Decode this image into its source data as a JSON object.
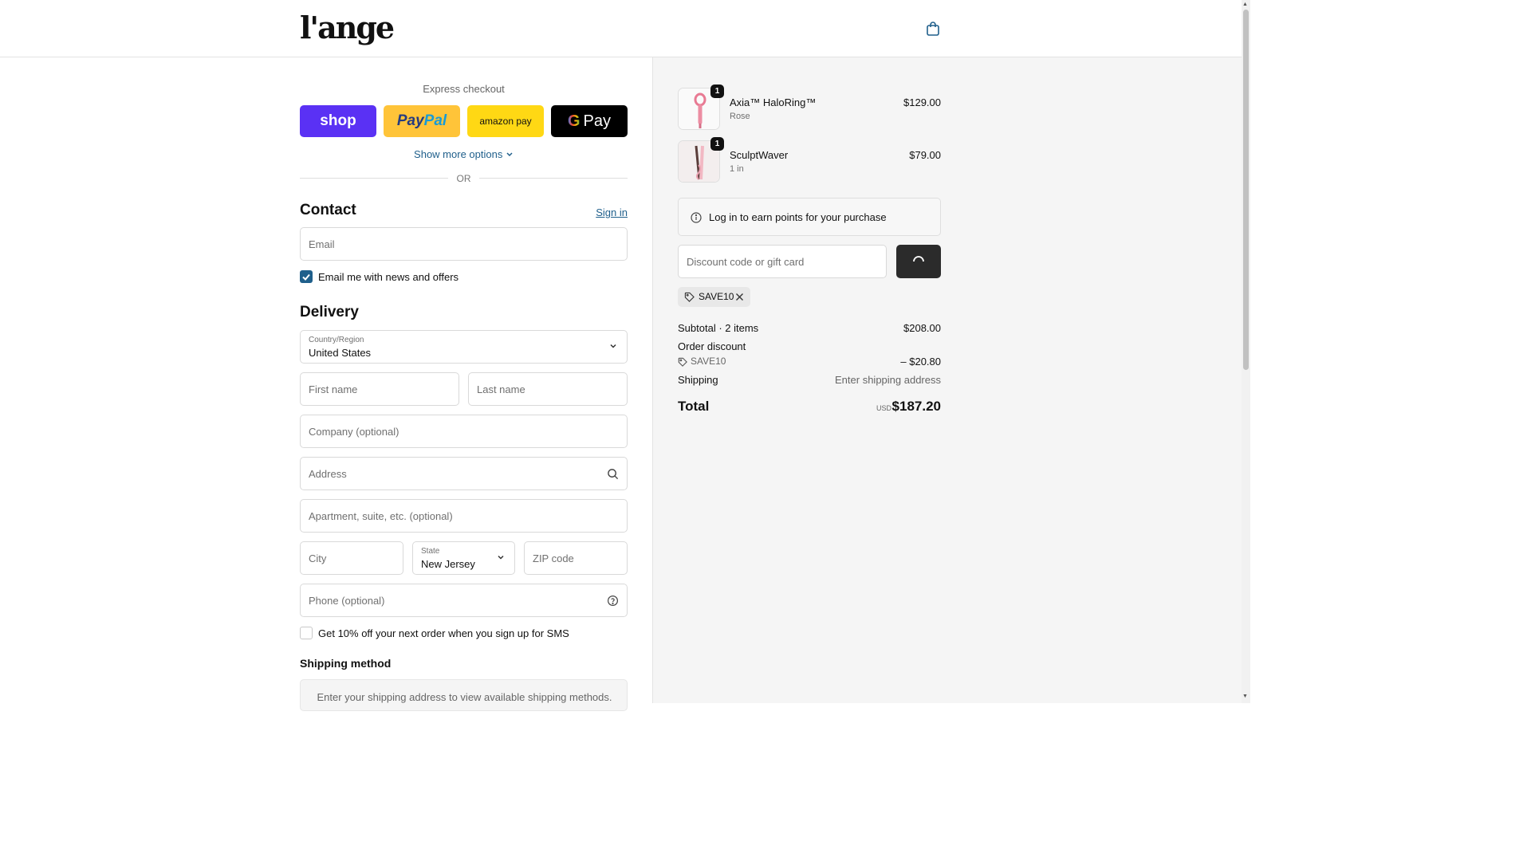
{
  "header": {
    "logo": "l'ange",
    "bag_icon": "shopping-bag-icon"
  },
  "express": {
    "title": "Express checkout",
    "buttons": {
      "shop": "shop",
      "paypal_1": "Pay",
      "paypal_2": "Pal",
      "amazon": "amazon pay",
      "gpay_g": "G",
      "gpay": "Pay"
    },
    "show_more": "Show more options",
    "or": "OR"
  },
  "contact": {
    "title": "Contact",
    "sign_in": "Sign in",
    "email_placeholder": "Email",
    "newsletter_label": "Email me with news and offers",
    "newsletter_checked": true
  },
  "delivery": {
    "title": "Delivery",
    "country_label": "Country/Region",
    "country_value": "United States",
    "first_name": "First name",
    "last_name": "Last name",
    "company": "Company (optional)",
    "address": "Address",
    "apartment": "Apartment, suite, etc. (optional)",
    "city": "City",
    "state_label": "State",
    "state_value": "New Jersey",
    "zip": "ZIP code",
    "phone": "Phone (optional)",
    "sms_label": "Get 10% off your next order when you sign up for SMS",
    "sms_checked": false
  },
  "shipping": {
    "title": "Shipping method",
    "message": "Enter your shipping address to view available shipping methods."
  },
  "cart": {
    "items": [
      {
        "name": "Axia™ HaloRing™",
        "variant": "Rose",
        "price": "$129.00",
        "qty": "1"
      },
      {
        "name": "SculptWaver",
        "variant": "1 in",
        "price": "$79.00",
        "qty": "1"
      }
    ],
    "points_message": "Log in to earn points for your purchase",
    "discount_placeholder": "Discount code or gift card",
    "applied_code": "SAVE10",
    "subtotal_label": "Subtotal · 2 items",
    "subtotal_value": "$208.00",
    "order_discount_label": "Order discount",
    "discount_code": "SAVE10",
    "discount_value": "– $20.80",
    "shipping_label": "Shipping",
    "shipping_value": "Enter shipping address",
    "total_label": "Total",
    "currency": "USD",
    "total_value": "$187.20"
  },
  "colors": {
    "accent": "#1f5f8b",
    "shop": "#5a31f4",
    "paypal": "#ffc439",
    "amazon": "#ffd814",
    "panel": "#f5f5f5"
  }
}
